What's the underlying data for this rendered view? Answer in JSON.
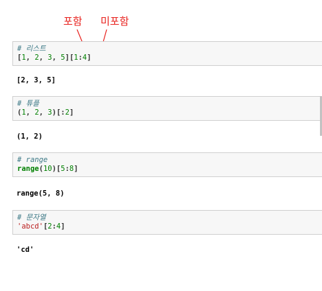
{
  "annotations": {
    "included": "포함",
    "excluded": "미포함"
  },
  "cells": [
    {
      "comment": "# 리스트",
      "code": {
        "open": "[",
        "a": "1",
        "s1": ", ",
        "b": "2",
        "s2": ", ",
        "c": "3",
        "s3": ", ",
        "d": "5",
        "close": "]",
        "slice_open": "[",
        "start": "1",
        "colon": ":",
        "end": "4",
        "slice_close": "]"
      },
      "output": "[2, 3, 5]"
    },
    {
      "comment": "# 튜플",
      "code": {
        "open": "(",
        "a": "1",
        "s1": ", ",
        "b": "2",
        "s2": ", ",
        "c": "3",
        "close": ")",
        "slice_open": "[",
        "colon": ":",
        "end": "2",
        "slice_close": "]"
      },
      "output": "(1, 2)"
    },
    {
      "comment": "# range",
      "code": {
        "fn": "range",
        "open": "(",
        "arg": "10",
        "close": ")",
        "slice_open": "[",
        "start": "5",
        "colon": ":",
        "end": "8",
        "slice_close": "]"
      },
      "output": "range(5, 8)"
    },
    {
      "comment": "# 문자열",
      "code": {
        "str": "'abcd'",
        "slice_open": "[",
        "start": "2",
        "colon": ":",
        "end": "4",
        "slice_close": "]"
      },
      "output": "'cd'"
    }
  ]
}
